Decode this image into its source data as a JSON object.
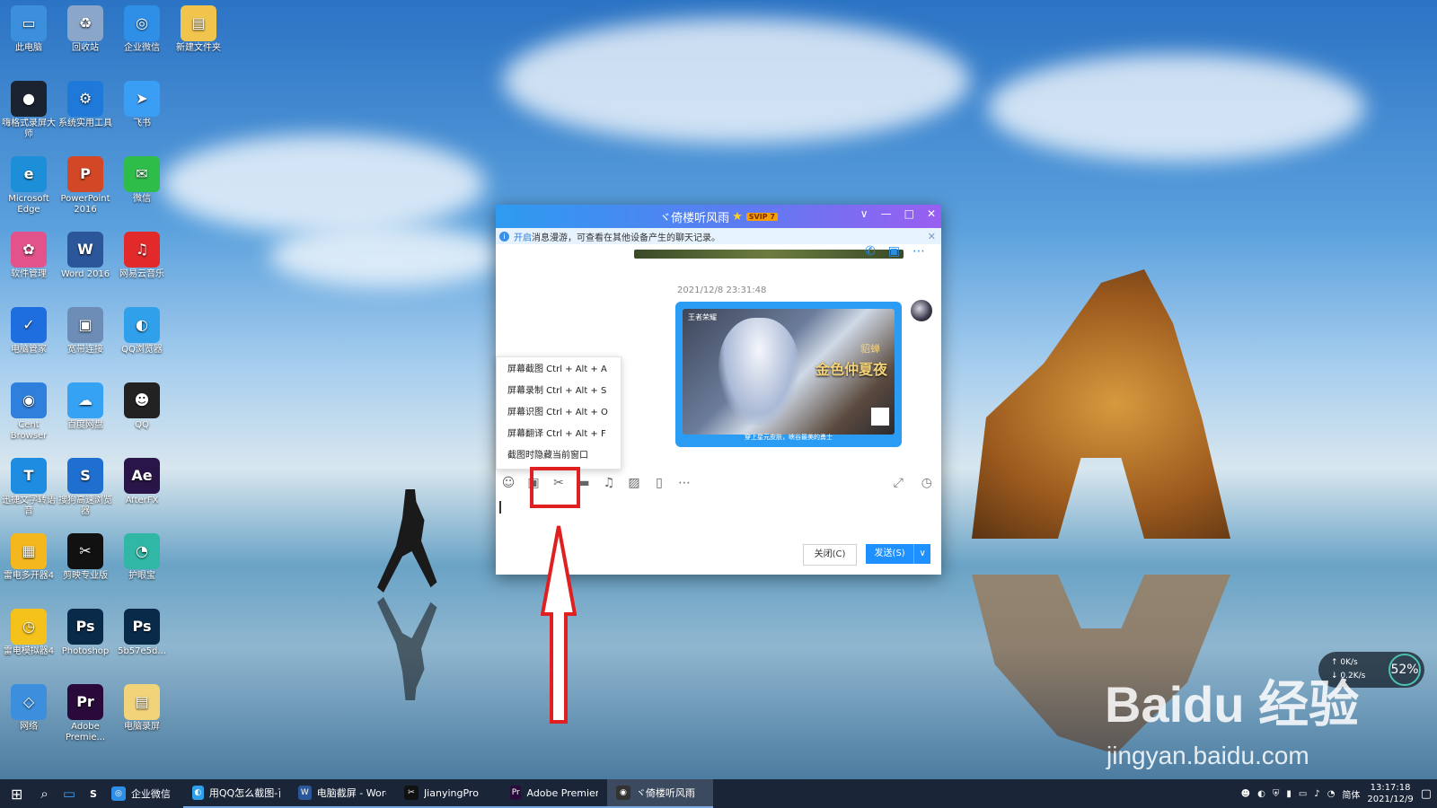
{
  "desktop_icons": [
    {
      "label": "此电脑",
      "color": "#3b8fdc",
      "glyph": "▭"
    },
    {
      "label": "回收站",
      "color": "#8aa6c8",
      "glyph": "♻"
    },
    {
      "label": "企业微信",
      "color": "#2f8fe6",
      "glyph": "◎"
    },
    {
      "label": "新建文件夹",
      "color": "#f1c44d",
      "glyph": "▤"
    },
    {
      "label": "嗨格式录屏大师",
      "color": "#1c2330",
      "glyph": "●"
    },
    {
      "label": "系统实用工具",
      "color": "#1e79d8",
      "glyph": "⚙"
    },
    {
      "label": "飞书",
      "color": "#3b9ef5",
      "glyph": "➤"
    },
    {
      "label": "Microsoft Edge",
      "color": "#1c8fd8",
      "glyph": "e"
    },
    {
      "label": "PowerPoint 2016",
      "color": "#d24726",
      "glyph": "P"
    },
    {
      "label": "微信",
      "color": "#2fbd4a",
      "glyph": "✉"
    },
    {
      "label": "软件管理",
      "color": "#e2528b",
      "glyph": "✿"
    },
    {
      "label": "Word 2016",
      "color": "#2b579a",
      "glyph": "W"
    },
    {
      "label": "网易云音乐",
      "color": "#e22a2a",
      "glyph": "♫"
    },
    {
      "label": "电脑管家",
      "color": "#1f6ee0",
      "glyph": "✓"
    },
    {
      "label": "宽带连接",
      "color": "#6d8cb6",
      "glyph": "▣"
    },
    {
      "label": "QQ浏览器",
      "color": "#2fa0e9",
      "glyph": "◐"
    },
    {
      "label": "Cent Browser",
      "color": "#2f7fdd",
      "glyph": "◉"
    },
    {
      "label": "百度网盘",
      "color": "#35a2f4",
      "glyph": "☁"
    },
    {
      "label": "QQ",
      "color": "#222",
      "glyph": "☻"
    },
    {
      "label": "迅捷文字转语音",
      "color": "#1e8ce0",
      "glyph": "T"
    },
    {
      "label": "搜狗高速浏览器",
      "color": "#1f6fd0",
      "glyph": "S"
    },
    {
      "label": "AfterFX",
      "color": "#2a1548",
      "glyph": "Ae"
    },
    {
      "label": "雷电多开器4",
      "color": "#f4b81e",
      "glyph": "▦"
    },
    {
      "label": "剪映专业版",
      "color": "#111",
      "glyph": "✂"
    },
    {
      "label": "护眼宝",
      "color": "#30b7a5",
      "glyph": "◔"
    },
    {
      "label": "雷电模拟器4",
      "color": "#f4c21a",
      "glyph": "◷"
    },
    {
      "label": "Photoshop",
      "color": "#0a2a4a",
      "glyph": "Ps"
    },
    {
      "label": "5b57e5d...",
      "color": "#0a2a4a",
      "glyph": "Ps"
    },
    {
      "label": "网络",
      "color": "#3b8fdc",
      "glyph": "◇"
    },
    {
      "label": "Adobe Premie...",
      "color": "#2a0a3a",
      "glyph": "Pr"
    },
    {
      "label": "电脑录屏",
      "color": "#f1d37a",
      "glyph": "▤"
    }
  ],
  "chat": {
    "title": "ヾ倚楼听风雨",
    "star": "★",
    "badge": "SVIP 7",
    "ctrl_dropdown": "∨",
    "ctrl_min": "—",
    "ctrl_max": "□",
    "ctrl_close": "✕",
    "notice_link": "开启",
    "notice_text": "消息漫游，可查看在其他设备产生的聊天记录。",
    "notice_close": "✕",
    "timestamp": "2021/12/8 23:31:48",
    "image_logo": "王者荣耀",
    "image_name": "貂蝉",
    "image_title": "金色仲夏夜",
    "image_caption": "穿上星元皮肤，峡谷最美的勇士",
    "menu": [
      "屏幕截图 Ctrl + Alt + A",
      "屏幕录制 Ctrl + Alt + S",
      "屏幕识图 Ctrl + Alt + O",
      "屏幕翻译 Ctrl + Alt + F",
      "截图时隐藏当前窗口"
    ],
    "toolbar": {
      "emoji": "☺",
      "gif": "▣",
      "scissors": "✂",
      "folder": "▬",
      "music": "♫",
      "image": "▨",
      "video": "▯",
      "more": "⋯",
      "expand": "⤢",
      "history": "◷"
    },
    "close_button": "关闭(C)",
    "send_button": "发送(S)",
    "send_dropdown": "∨"
  },
  "speed_widget": {
    "up": "↑ 0K/s",
    "down": "↓ 0.2K/s",
    "percent": "52%"
  },
  "watermark": {
    "line1": "Baidu 经验",
    "line2": "jingyan.baidu.com"
  },
  "taskbar": {
    "start": "⊞",
    "search": "⌕",
    "task_view": "▭",
    "sogou": "S",
    "pinned": [
      {
        "label": "企业微信",
        "color": "#2f8fe6",
        "glyph": "◎"
      }
    ],
    "tasks": [
      {
        "label": "用QQ怎么截图-百...",
        "color": "#2fa0e9",
        "glyph": "◐",
        "active": false
      },
      {
        "label": "电脑截屏 - Word",
        "color": "#2b579a",
        "glyph": "W",
        "active": false
      },
      {
        "label": "JianyingPro",
        "color": "#111",
        "glyph": "✂",
        "active": false
      },
      {
        "label": "Adobe Premiere ...",
        "color": "#2a0a3a",
        "glyph": "Pr",
        "active": false
      },
      {
        "label": "ヾ倚楼听风雨",
        "color": "#333",
        "glyph": "◉",
        "active": true
      }
    ],
    "ime": "简体",
    "time": "13:17:18",
    "date": "2021/12/9"
  }
}
